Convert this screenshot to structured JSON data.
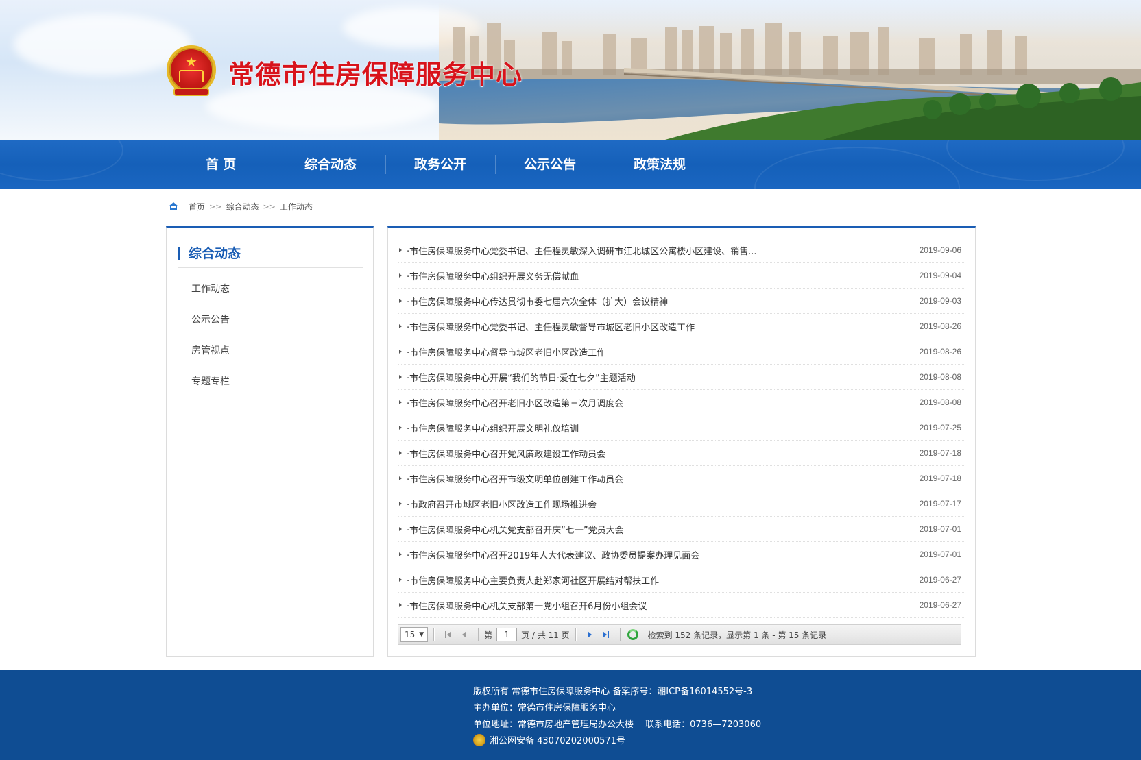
{
  "header": {
    "site_title": "常德市住房保障服务中心"
  },
  "nav": {
    "items": [
      {
        "label": "首 页"
      },
      {
        "label": "综合动态"
      },
      {
        "label": "政务公开"
      },
      {
        "label": "公示公告"
      },
      {
        "label": "政策法规"
      }
    ]
  },
  "breadcrumb": {
    "home": "首页",
    "section": "综合动态",
    "current": "工作动态",
    "separator": ">>"
  },
  "sidebar": {
    "title": "综合动态",
    "items": [
      {
        "label": "工作动态"
      },
      {
        "label": "公示公告"
      },
      {
        "label": "房管视点"
      },
      {
        "label": "专题专栏"
      }
    ]
  },
  "news": [
    {
      "title": "·市住房保障服务中心党委书记、主任程灵敏深入调研市江北城区公寓楼小区建设、销售...",
      "date": "2019-09-06"
    },
    {
      "title": "·市住房保障服务中心组织开展义务无偿献血",
      "date": "2019-09-04"
    },
    {
      "title": "·市住房保障服务中心传达贯彻市委七届六次全体（扩大）会议精神",
      "date": "2019-09-03"
    },
    {
      "title": "·市住房保障服务中心党委书记、主任程灵敏督导市城区老旧小区改造工作",
      "date": "2019-08-26"
    },
    {
      "title": "·市住房保障服务中心督导市城区老旧小区改造工作",
      "date": "2019-08-26"
    },
    {
      "title": "·市住房保障服务中心开展“我们的节日·爱在七夕”主题活动",
      "date": "2019-08-08"
    },
    {
      "title": "·市住房保障服务中心召开老旧小区改造第三次月调度会",
      "date": "2019-08-08"
    },
    {
      "title": "·市住房保障服务中心组织开展文明礼仪培训",
      "date": "2019-07-25"
    },
    {
      "title": "·市住房保障服务中心召开党风廉政建设工作动员会",
      "date": "2019-07-18"
    },
    {
      "title": "·市住房保障服务中心召开市级文明单位创建工作动员会",
      "date": "2019-07-18"
    },
    {
      "title": "·市政府召开市城区老旧小区改造工作现场推进会",
      "date": "2019-07-17"
    },
    {
      "title": "·市住房保障服务中心机关党支部召开庆“七一”党员大会",
      "date": "2019-07-01"
    },
    {
      "title": "·市住房保障服务中心召开2019年人大代表建议、政协委员提案办理见面会",
      "date": "2019-07-01"
    },
    {
      "title": "·市住房保障服务中心主要负责人赴郑家河社区开展结对帮扶工作",
      "date": "2019-06-27"
    },
    {
      "title": "·市住房保障服务中心机关支部第一党小组召开6月份小组会议",
      "date": "2019-06-27"
    }
  ],
  "pager": {
    "page_size": "15",
    "page_prefix": "第",
    "current_page": "1",
    "page_suffix": "页 / 共 11 页",
    "info": "检索到 152 条记录，显示第 1 条 - 第 15 条记录"
  },
  "footer": {
    "copyright": "版权所有 常德市住房保障服务中心 备案序号：湘ICP备16014552号-3",
    "organizer": "主办单位：常德市住房保障服务中心",
    "address": "单位地址：常德市房地产管理局办公大楼　 联系电话：0736—7203060",
    "police_record": "湘公网安备 43070202000571号"
  },
  "colors": {
    "title_red": "#d8131b",
    "nav_blue": "#1560b9",
    "accent_blue": "#1a5db4",
    "footer_blue": "#0f4d93"
  }
}
